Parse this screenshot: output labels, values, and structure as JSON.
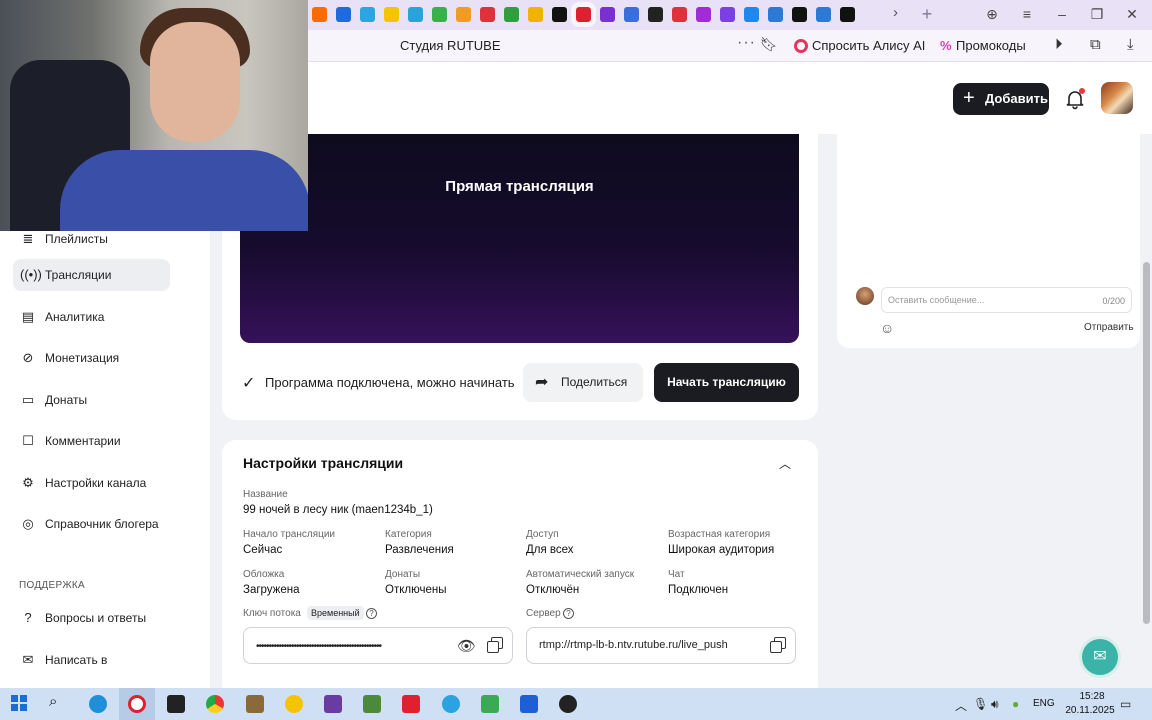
{
  "browser": {
    "site_title": "Студия RUTUBE",
    "alice_label": "Спросить Алису AI",
    "promo_label": "Промокоды",
    "tab_colors": [
      "#ff6a00",
      "#1e6be0",
      "#2aa7e0",
      "#f5c400",
      "#27a4d8",
      "#35b24a",
      "#f29c1f",
      "#e0303b",
      "#2e9e3e",
      "#f0b400",
      "#111111",
      "#e0202f",
      "#7a2fd0",
      "#3a6ddd",
      "#222222",
      "#e0303b",
      "#a12bd6",
      "#7c3fe3",
      "#1e87f0",
      "#2d7ad6",
      "#111111",
      "#2d7ad6",
      "#111111"
    ]
  },
  "header": {
    "add_label": "Добавить"
  },
  "sidebar": {
    "items": [
      {
        "label": "Плейлисты",
        "icon": "playlist-icon"
      },
      {
        "label": "Трансляции",
        "icon": "broadcast-icon",
        "active": true
      },
      {
        "label": "Аналитика",
        "icon": "analytics-icon"
      },
      {
        "label": "Монетизация",
        "icon": "monetization-icon"
      },
      {
        "label": "Донаты",
        "icon": "donations-icon"
      },
      {
        "label": "Комментарии",
        "icon": "comments-icon"
      },
      {
        "label": "Настройки канала",
        "icon": "settings-icon"
      },
      {
        "label": "Справочник блогера",
        "icon": "guide-icon"
      }
    ],
    "support_label": "ПОДДЕРЖКА",
    "support_items": [
      {
        "label": "Вопросы и ответы",
        "icon": "faq-icon"
      },
      {
        "label": "Написать в поддержку",
        "icon": "mail-icon"
      }
    ]
  },
  "player": {
    "title": "Прямая трансляция",
    "status": "Программа подключена, можно начинать",
    "share_label": "Поделиться",
    "start_label": "Начать трансляцию"
  },
  "chat": {
    "placeholder": "Оставить сообщение...",
    "counter": "0/200",
    "send_label": "Отправить"
  },
  "settings": {
    "title": "Настройки трансляции",
    "name_label": "Название",
    "name_value": "99 ночей в лесу ник (maen1234b_1)",
    "fields": [
      {
        "label": "Начало трансляции",
        "value": "Сейчас"
      },
      {
        "label": "Категория",
        "value": "Развлечения"
      },
      {
        "label": "Доступ",
        "value": "Для всех"
      },
      {
        "label": "Возрастная категория",
        "value": "Широкая аудитория"
      },
      {
        "label": "Обложка",
        "value": "Загружена"
      },
      {
        "label": "Донаты",
        "value": "Отключены"
      },
      {
        "label": "Автоматический запуск",
        "value": "Отключён"
      },
      {
        "label": "Чат",
        "value": "Подключен"
      }
    ],
    "key_label": "Ключ потока",
    "key_badge": "Временный",
    "key_value": "••••••••••••••••••••••••••••••••••••••••••••••••••",
    "server_label": "Сервер",
    "server_value": "rtmp://rtmp-lb-b.ntv.rutube.ru/live_push"
  },
  "taskbar": {
    "lang": "ENG",
    "time": "15:28",
    "date": "20.11.2025"
  }
}
